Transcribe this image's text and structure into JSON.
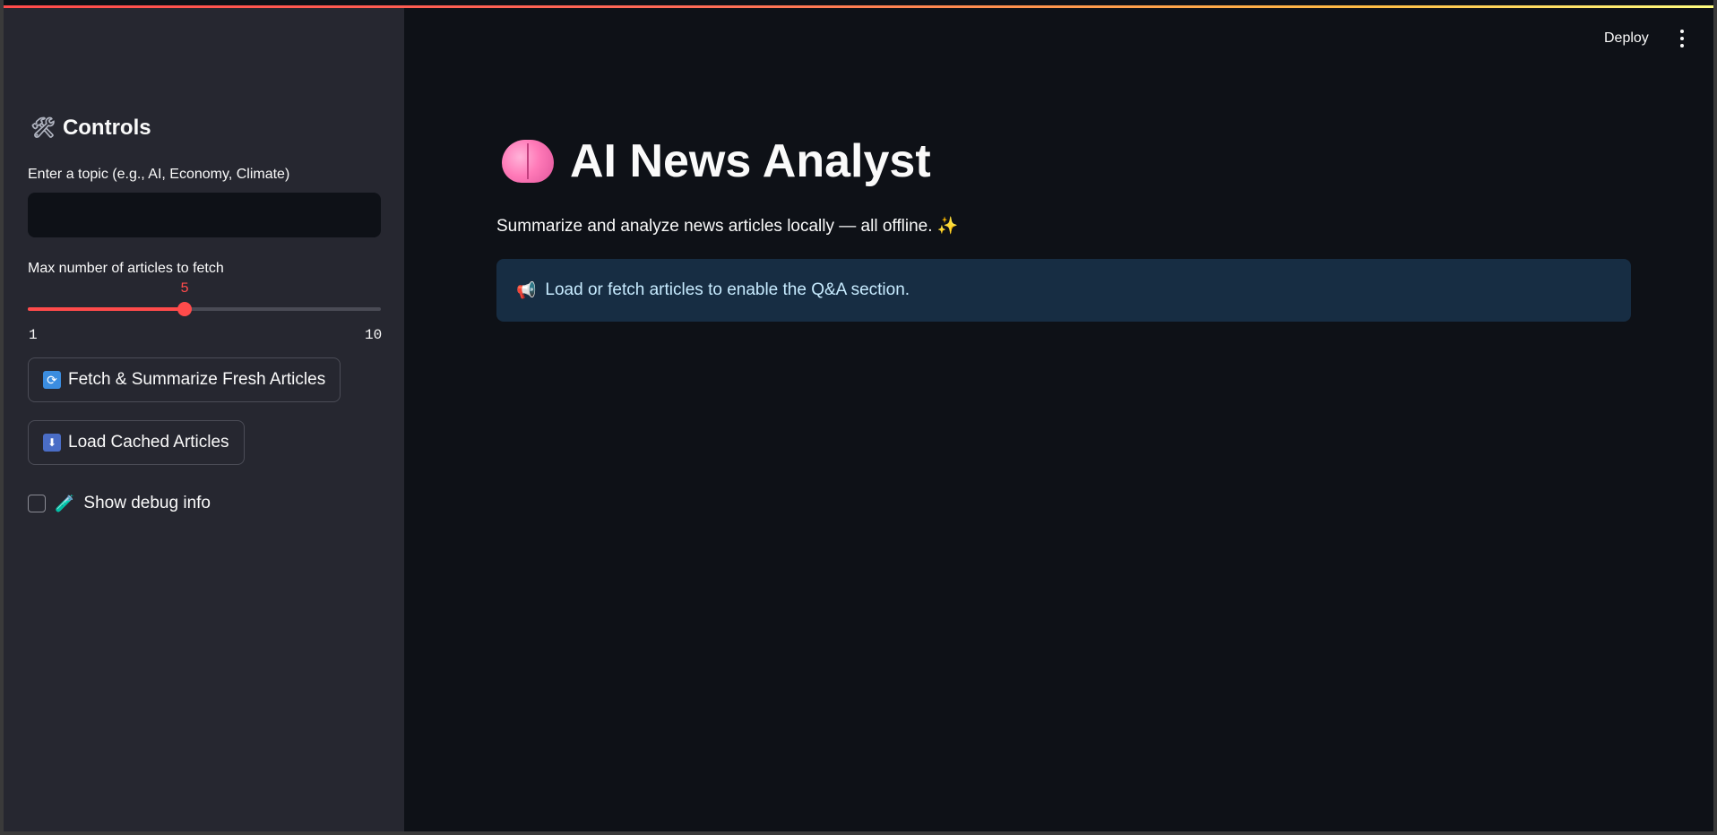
{
  "header": {
    "deploy_label": "Deploy",
    "menu_icon": "kebab-menu-icon"
  },
  "sidebar": {
    "title": "Controls",
    "title_icon": "tools-icon",
    "topic_label": "Enter a topic (e.g., AI, Economy, Climate)",
    "topic_value": "",
    "slider": {
      "label": "Max number of articles to fetch",
      "value": "5",
      "value_num": 5,
      "min": "1",
      "max": "10",
      "min_num": 1,
      "max_num": 10
    },
    "fetch_button": "Fetch & Summarize Fresh Articles",
    "load_button": "Load Cached Articles",
    "debug_checkbox": "Show debug info",
    "debug_checked": false
  },
  "main": {
    "title": "AI News Analyst",
    "title_icon": "brain-icon",
    "subtitle": "Summarize and analyze news articles locally — all offline.",
    "info_message": "Load or fetch articles to enable the Q&A section."
  },
  "colors": {
    "accent": "#ff4b4b",
    "sidebar_bg": "#262730",
    "main_bg": "#0e1117",
    "info_bg": "#172d43",
    "info_text": "#c7ebff"
  }
}
